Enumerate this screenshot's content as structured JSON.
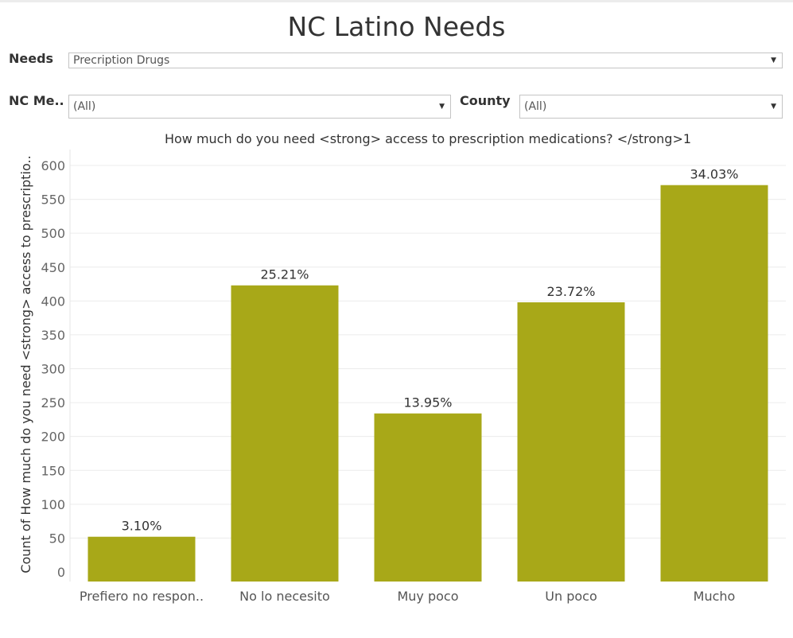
{
  "dashboard": {
    "title": "NC Latino Needs"
  },
  "filters": {
    "needs": {
      "label": "Needs",
      "value": "Precription Drugs"
    },
    "nc_me": {
      "label": "NC Me..",
      "value": "(All)"
    },
    "county": {
      "label": "County",
      "value": "(All)"
    }
  },
  "colors": {
    "bar": "#a8a818",
    "gridline": "#ececec"
  },
  "chart_data": {
    "type": "bar",
    "title": "How much do you need <strong> access to prescription medications? </strong>1",
    "ylabel": "Count of How much do you need <strong> access to prescriptio..",
    "xlabel": "",
    "categories": [
      "Prefiero no respon..",
      "No lo necesito",
      "Muy poco",
      "Un poco",
      "Mucho"
    ],
    "values": [
      52,
      423,
      234,
      398,
      571
    ],
    "data_labels": [
      "3.10%",
      "25.21%",
      "13.95%",
      "23.72%",
      "34.03%"
    ],
    "ylim": [
      0,
      620
    ],
    "yticks": [
      0,
      50,
      100,
      150,
      200,
      250,
      300,
      350,
      400,
      450,
      500,
      550,
      600
    ],
    "grid": true,
    "legend": "none"
  }
}
